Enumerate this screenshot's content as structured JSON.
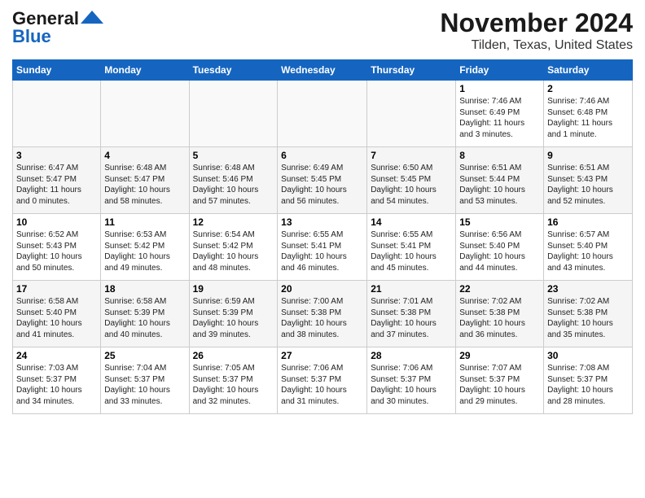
{
  "logo": {
    "line1": "General",
    "line2": "Blue"
  },
  "title": "November 2024",
  "location": "Tilden, Texas, United States",
  "days_header": [
    "Sunday",
    "Monday",
    "Tuesday",
    "Wednesday",
    "Thursday",
    "Friday",
    "Saturday"
  ],
  "weeks": [
    [
      {
        "day": "",
        "info": ""
      },
      {
        "day": "",
        "info": ""
      },
      {
        "day": "",
        "info": ""
      },
      {
        "day": "",
        "info": ""
      },
      {
        "day": "",
        "info": ""
      },
      {
        "day": "1",
        "info": "Sunrise: 7:46 AM\nSunset: 6:49 PM\nDaylight: 11 hours\nand 3 minutes."
      },
      {
        "day": "2",
        "info": "Sunrise: 7:46 AM\nSunset: 6:48 PM\nDaylight: 11 hours\nand 1 minute."
      }
    ],
    [
      {
        "day": "3",
        "info": "Sunrise: 6:47 AM\nSunset: 5:47 PM\nDaylight: 11 hours\nand 0 minutes."
      },
      {
        "day": "4",
        "info": "Sunrise: 6:48 AM\nSunset: 5:47 PM\nDaylight: 10 hours\nand 58 minutes."
      },
      {
        "day": "5",
        "info": "Sunrise: 6:48 AM\nSunset: 5:46 PM\nDaylight: 10 hours\nand 57 minutes."
      },
      {
        "day": "6",
        "info": "Sunrise: 6:49 AM\nSunset: 5:45 PM\nDaylight: 10 hours\nand 56 minutes."
      },
      {
        "day": "7",
        "info": "Sunrise: 6:50 AM\nSunset: 5:45 PM\nDaylight: 10 hours\nand 54 minutes."
      },
      {
        "day": "8",
        "info": "Sunrise: 6:51 AM\nSunset: 5:44 PM\nDaylight: 10 hours\nand 53 minutes."
      },
      {
        "day": "9",
        "info": "Sunrise: 6:51 AM\nSunset: 5:43 PM\nDaylight: 10 hours\nand 52 minutes."
      }
    ],
    [
      {
        "day": "10",
        "info": "Sunrise: 6:52 AM\nSunset: 5:43 PM\nDaylight: 10 hours\nand 50 minutes."
      },
      {
        "day": "11",
        "info": "Sunrise: 6:53 AM\nSunset: 5:42 PM\nDaylight: 10 hours\nand 49 minutes."
      },
      {
        "day": "12",
        "info": "Sunrise: 6:54 AM\nSunset: 5:42 PM\nDaylight: 10 hours\nand 48 minutes."
      },
      {
        "day": "13",
        "info": "Sunrise: 6:55 AM\nSunset: 5:41 PM\nDaylight: 10 hours\nand 46 minutes."
      },
      {
        "day": "14",
        "info": "Sunrise: 6:55 AM\nSunset: 5:41 PM\nDaylight: 10 hours\nand 45 minutes."
      },
      {
        "day": "15",
        "info": "Sunrise: 6:56 AM\nSunset: 5:40 PM\nDaylight: 10 hours\nand 44 minutes."
      },
      {
        "day": "16",
        "info": "Sunrise: 6:57 AM\nSunset: 5:40 PM\nDaylight: 10 hours\nand 43 minutes."
      }
    ],
    [
      {
        "day": "17",
        "info": "Sunrise: 6:58 AM\nSunset: 5:40 PM\nDaylight: 10 hours\nand 41 minutes."
      },
      {
        "day": "18",
        "info": "Sunrise: 6:58 AM\nSunset: 5:39 PM\nDaylight: 10 hours\nand 40 minutes."
      },
      {
        "day": "19",
        "info": "Sunrise: 6:59 AM\nSunset: 5:39 PM\nDaylight: 10 hours\nand 39 minutes."
      },
      {
        "day": "20",
        "info": "Sunrise: 7:00 AM\nSunset: 5:38 PM\nDaylight: 10 hours\nand 38 minutes."
      },
      {
        "day": "21",
        "info": "Sunrise: 7:01 AM\nSunset: 5:38 PM\nDaylight: 10 hours\nand 37 minutes."
      },
      {
        "day": "22",
        "info": "Sunrise: 7:02 AM\nSunset: 5:38 PM\nDaylight: 10 hours\nand 36 minutes."
      },
      {
        "day": "23",
        "info": "Sunrise: 7:02 AM\nSunset: 5:38 PM\nDaylight: 10 hours\nand 35 minutes."
      }
    ],
    [
      {
        "day": "24",
        "info": "Sunrise: 7:03 AM\nSunset: 5:37 PM\nDaylight: 10 hours\nand 34 minutes."
      },
      {
        "day": "25",
        "info": "Sunrise: 7:04 AM\nSunset: 5:37 PM\nDaylight: 10 hours\nand 33 minutes."
      },
      {
        "day": "26",
        "info": "Sunrise: 7:05 AM\nSunset: 5:37 PM\nDaylight: 10 hours\nand 32 minutes."
      },
      {
        "day": "27",
        "info": "Sunrise: 7:06 AM\nSunset: 5:37 PM\nDaylight: 10 hours\nand 31 minutes."
      },
      {
        "day": "28",
        "info": "Sunrise: 7:06 AM\nSunset: 5:37 PM\nDaylight: 10 hours\nand 30 minutes."
      },
      {
        "day": "29",
        "info": "Sunrise: 7:07 AM\nSunset: 5:37 PM\nDaylight: 10 hours\nand 29 minutes."
      },
      {
        "day": "30",
        "info": "Sunrise: 7:08 AM\nSunset: 5:37 PM\nDaylight: 10 hours\nand 28 minutes."
      }
    ]
  ]
}
